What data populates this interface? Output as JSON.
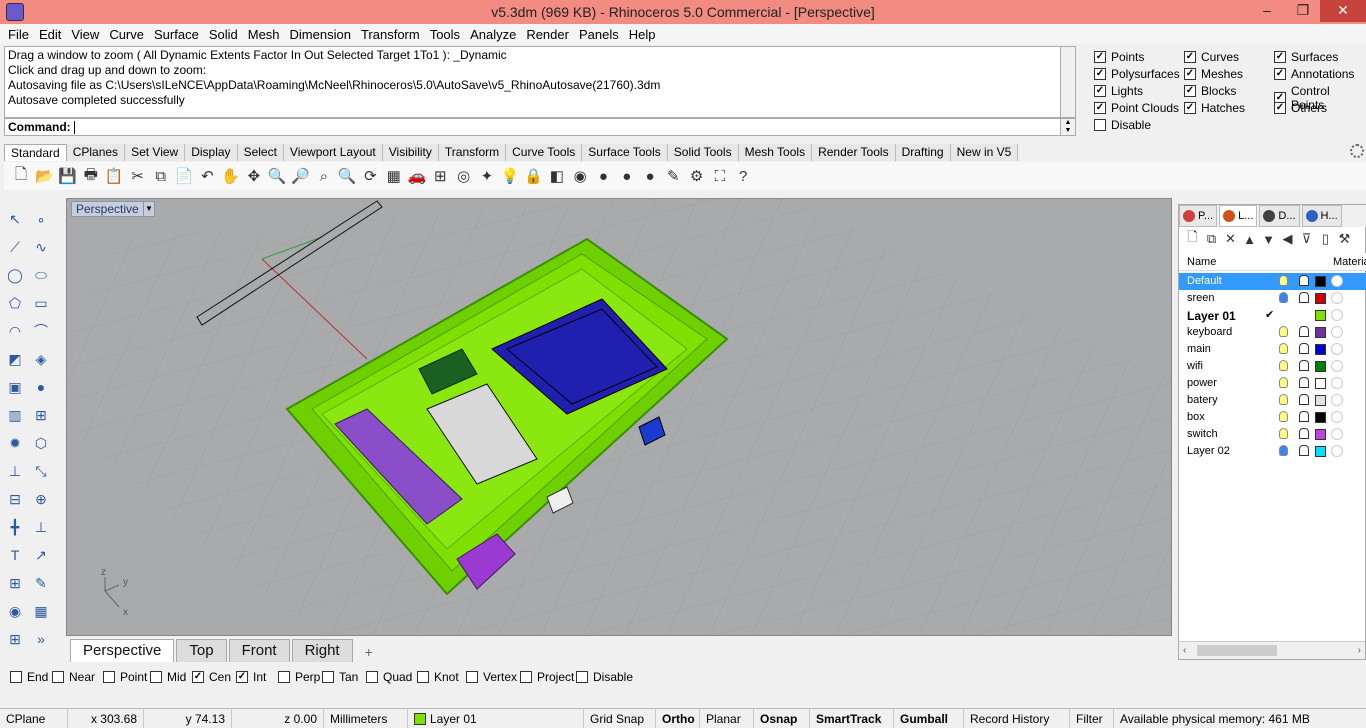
{
  "window": {
    "title": "v5.3dm (969 KB) - Rhinoceros 5.0 Commercial - [Perspective]",
    "minimize": "–",
    "restore": "❐",
    "close": "✕"
  },
  "menu": [
    "File",
    "Edit",
    "View",
    "Curve",
    "Surface",
    "Solid",
    "Mesh",
    "Dimension",
    "Transform",
    "Tools",
    "Analyze",
    "Render",
    "Panels",
    "Help"
  ],
  "history": [
    "Drag a window to zoom ( All  Dynamic  Extents  Factor  In  Out  Selected  Target  1To1 ): _Dynamic",
    "Click and drag up and down to zoom:",
    "Autosaving file as C:\\Users\\sILeNCE\\AppData\\Roaming\\McNeel\\Rhinoceros\\5.0\\AutoSave\\v5_RhinoAutosave(21760).3dm",
    "Autosave completed successfully"
  ],
  "command": {
    "label": "Command:",
    "value": ""
  },
  "filters": [
    {
      "label": "Points",
      "checked": true
    },
    {
      "label": "Curves",
      "checked": true
    },
    {
      "label": "Surfaces",
      "checked": true
    },
    {
      "label": "Polysurfaces",
      "checked": true
    },
    {
      "label": "Meshes",
      "checked": true
    },
    {
      "label": "Annotations",
      "checked": true
    },
    {
      "label": "Lights",
      "checked": true
    },
    {
      "label": "Blocks",
      "checked": true
    },
    {
      "label": "Control Points",
      "checked": true
    },
    {
      "label": "Point Clouds",
      "checked": true
    },
    {
      "label": "Hatches",
      "checked": true
    },
    {
      "label": "Others",
      "checked": true
    },
    {
      "label": "Disable",
      "checked": false
    }
  ],
  "toolbar_tabs": [
    "Standard",
    "CPlanes",
    "Set View",
    "Display",
    "Select",
    "Viewport Layout",
    "Visibility",
    "Transform",
    "Curve Tools",
    "Surface Tools",
    "Solid Tools",
    "Mesh Tools",
    "Render Tools",
    "Drafting",
    "New in V5"
  ],
  "toolbar_icons": [
    "new-icon",
    "open-icon",
    "save-icon",
    "print-icon",
    "import-icon",
    "cut-icon",
    "copy-icon",
    "paste-icon",
    "undo-icon",
    "pan-icon",
    "rotate-view-icon",
    "zoom-dynamic-icon",
    "zoom-window-icon",
    "zoom-extents-icon",
    "zoom-selected-icon",
    "rotate-icon",
    "viewport-layout-icon",
    "car-icon",
    "grid-icon",
    "cplane-icon",
    "point-icon",
    "light-icon",
    "lock-icon",
    "layer-icon",
    "color-wheel-icon",
    "sphere-gray-icon",
    "sphere-dark-icon",
    "sphere-blue-icon",
    "pen-icon",
    "gear-settings-icon",
    "fit-icon",
    "help-icon"
  ],
  "toolbar_glyphs": [
    "🗋",
    "📂",
    "💾",
    "🖶",
    "📋",
    "✂",
    "⧉",
    "📄",
    "↶",
    "✋",
    "✥",
    "🔍",
    "🔎",
    "⌕",
    "🔍",
    "⟳",
    "▦",
    "🚗",
    "⊞",
    "◎",
    "✦",
    "💡",
    "🔒",
    "◧",
    "◉",
    "●",
    "●",
    "●",
    "✎",
    "⚙",
    "⛶",
    "?"
  ],
  "viewport": {
    "label": "Perspective",
    "dropdown": "▼",
    "axes": {
      "x": "x",
      "y": "y",
      "z": "z"
    }
  },
  "view_tabs": [
    "Perspective",
    "Top",
    "Front",
    "Right"
  ],
  "view_tab_add": "+",
  "layers_panel": {
    "tabs": [
      {
        "label": "P...",
        "color": "#d04040"
      },
      {
        "label": "L...",
        "color": "#d05020"
      },
      {
        "label": "D...",
        "color": "#404040"
      },
      {
        "label": "H...",
        "color": "#3060c0"
      }
    ],
    "tools": [
      "🗋",
      "⧉",
      "✕",
      "▲",
      "▼",
      "◀",
      "⊽",
      "▯",
      "⚒"
    ],
    "columns": {
      "name": "Name",
      "material": "Materia"
    },
    "rows": [
      {
        "name": "Default",
        "bulb": "#ffff80",
        "color": "#000000",
        "selected": true,
        "current": false
      },
      {
        "name": "sreen",
        "bulb": "#3b82f6",
        "color": "#d00000",
        "selected": false,
        "current": false
      },
      {
        "name": "Layer 01",
        "bulb": "",
        "color": "#80e000",
        "selected": false,
        "current": true,
        "check": "✔"
      },
      {
        "name": "keyboard",
        "bulb": "#ffff80",
        "color": "#7030a0",
        "selected": false,
        "current": false
      },
      {
        "name": "main",
        "bulb": "#ffff80",
        "color": "#0000d0",
        "selected": false,
        "current": false
      },
      {
        "name": "wifi",
        "bulb": "#ffff80",
        "color": "#008000",
        "selected": false,
        "current": false
      },
      {
        "name": "power",
        "bulb": "#ffff80",
        "color": "#ffffff",
        "selected": false,
        "current": false
      },
      {
        "name": "batery",
        "bulb": "#ffff80",
        "color": "#e0e0e0",
        "selected": false,
        "current": false
      },
      {
        "name": "box",
        "bulb": "#ffff80",
        "color": "#000000",
        "selected": false,
        "current": false
      },
      {
        "name": "switch",
        "bulb": "#ffff80",
        "color": "#c040e0",
        "selected": false,
        "current": false
      },
      {
        "name": "Layer 02",
        "bulb": "#3b82f6",
        "color": "#00e0ff",
        "selected": false,
        "current": false
      }
    ]
  },
  "osnaps": [
    {
      "label": "End",
      "checked": false
    },
    {
      "label": "Near",
      "checked": false
    },
    {
      "label": "Point",
      "checked": false
    },
    {
      "label": "Mid",
      "checked": false
    },
    {
      "label": "Cen",
      "checked": true
    },
    {
      "label": "Int",
      "checked": true
    },
    {
      "label": "Perp",
      "checked": false
    },
    {
      "label": "Tan",
      "checked": false
    },
    {
      "label": "Quad",
      "checked": false
    },
    {
      "label": "Knot",
      "checked": false
    },
    {
      "label": "Vertex",
      "checked": false
    },
    {
      "label": "Project",
      "checked": false
    },
    {
      "label": "Disable",
      "checked": false
    }
  ],
  "status": {
    "cplane": "CPlane",
    "x": "x 303.68",
    "y": "y 74.13",
    "z": "z 0.00",
    "units": "Millimeters",
    "layer": "Layer 01",
    "layer_color": "#80e000",
    "grid_snap": "Grid Snap",
    "ortho": "Ortho",
    "planar": "Planar",
    "osnap": "Osnap",
    "smarttrack": "SmartTrack",
    "gumball": "Gumball",
    "record_history": "Record History",
    "filter": "Filter",
    "memory": "Available physical memory: 461 MB"
  },
  "colors": {
    "accent": "#3399ff",
    "titlebar": "#f28b82",
    "model_green": "#7fe000",
    "model_blue": "#2020b0",
    "model_purple": "#8040c0"
  }
}
